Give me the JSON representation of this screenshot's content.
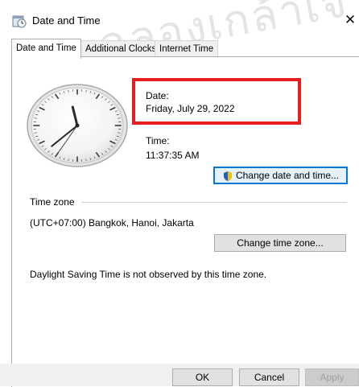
{
  "window": {
    "title": "Date and Time",
    "close_glyph": "✕"
  },
  "watermark": {
    "text": "ฉลองเกล้าเจ้า"
  },
  "tabs": [
    {
      "label": "Date and Time",
      "active": true
    },
    {
      "label": "Additional Clocks",
      "active": false
    },
    {
      "label": "Internet Time",
      "active": false
    }
  ],
  "clock": {
    "hour": 11,
    "minute": 37,
    "second": 35
  },
  "date": {
    "label": "Date:",
    "value": "Friday, July 29, 2022"
  },
  "time": {
    "label": "Time:",
    "value": "11:37:35 AM"
  },
  "buttons": {
    "change_datetime": "Change date and time...",
    "change_timezone": "Change time zone...",
    "ok": "OK",
    "cancel": "Cancel",
    "apply": "Apply"
  },
  "timezone": {
    "group_label": "Time zone",
    "value": "(UTC+07:00) Bangkok, Hanoi, Jakarta",
    "dst_note": "Daylight Saving Time is not observed by this time zone."
  },
  "colors": {
    "highlight": "#e61e1e",
    "accent": "#0078d7"
  },
  "icons": {
    "app": "date-time-app-icon",
    "shield": "uac-shield-icon",
    "close": "close-icon"
  }
}
